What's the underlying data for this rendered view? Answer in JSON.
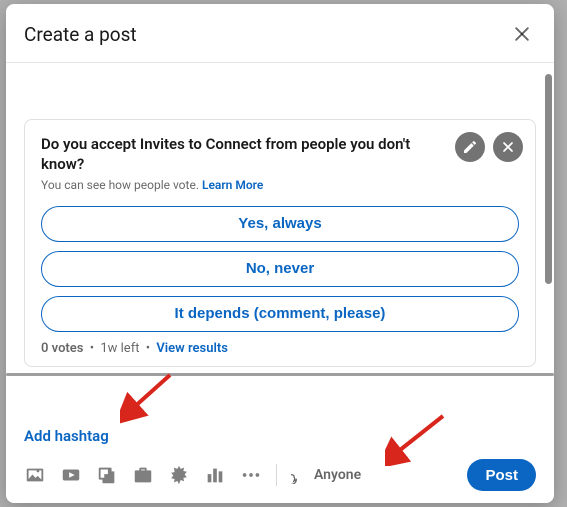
{
  "header": {
    "title": "Create a post"
  },
  "poll": {
    "question": "Do you accept Invites to Connect from people you don't know?",
    "subtext": "You can see how people vote.",
    "learn_more": "Learn More",
    "options": [
      "Yes, always",
      "No, never",
      "It depends (comment, please)"
    ],
    "votes_label": "0 votes",
    "time_left": "1w left",
    "view_results": "View results"
  },
  "composer": {
    "add_hashtag": "Add hashtag"
  },
  "footer": {
    "visibility_label": "Anyone",
    "post_label": "Post"
  },
  "colors": {
    "primary": "#0a66c2",
    "icon_gray": "rgba(0,0,0,0.5)"
  }
}
